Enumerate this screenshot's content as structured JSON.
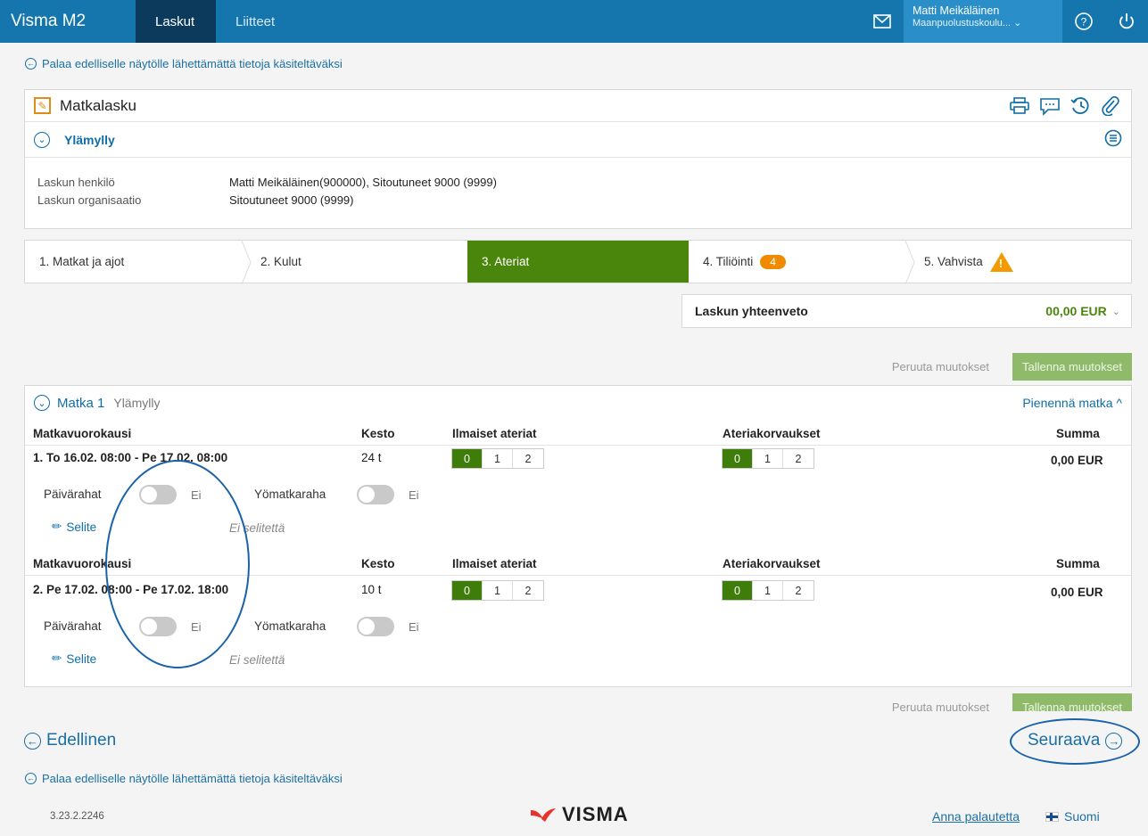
{
  "app": {
    "brand": "Visma M2"
  },
  "nav": {
    "tabs": [
      {
        "label": "Laskut"
      },
      {
        "label": "Liitteet"
      }
    ]
  },
  "user": {
    "name": "Matti Meikäläinen",
    "org": "Maanpuolustuskoulu..."
  },
  "back_link_top": "Palaa edelliselle näytölle lähettämättä tietoja käsiteltäväksi",
  "back_link_bottom": "Palaa edelliselle näytölle lähettämättä tietoja käsiteltäväksi",
  "invoice": {
    "title": "Matkalasku",
    "trip_name": "Ylämylly",
    "person_label": "Laskun henkilö",
    "person_value": "Matti Meikäläinen(900000), Sitoutuneet 9000 (9999)",
    "org_label": "Laskun organisaatio",
    "org_value": "Sitoutuneet 9000 (9999)"
  },
  "steps": [
    {
      "label": "1. Matkat ja ajot"
    },
    {
      "label": "2. Kulut"
    },
    {
      "label": "3. Ateriat"
    },
    {
      "label": "4. Tiliöinti",
      "badge": "4"
    },
    {
      "label": "5. Vahvista"
    }
  ],
  "summary": {
    "label": "Laskun yhteenveto",
    "amount": "00,00 EUR"
  },
  "actions": {
    "cancel": "Peruuta muutokset",
    "save": "Tallenna muutokset"
  },
  "trip": {
    "label": "Matka 1",
    "name": "Ylämylly",
    "collapse": "Pienennä matka",
    "columns": {
      "period": "Matkavuorokausi",
      "duration": "Kesto",
      "free_meals": "Ilmaiset ateriat",
      "meal_comp": "Ateriakorvaukset",
      "sum": "Summa"
    },
    "days": [
      {
        "period": "1. To 16.02. 08:00 - Pe 17.02. 08:00",
        "duration": "24 t",
        "free_meals": [
          "0",
          "1",
          "2"
        ],
        "meal_comp": [
          "0",
          "1",
          "2"
        ],
        "sum": "0,00 EUR",
        "allowance_label": "Päivärahat",
        "allowance_value": "Ei",
        "night_label": "Yömatkaraha",
        "night_value": "Ei",
        "note_label": "Selite",
        "note_value": "Ei selitettä"
      },
      {
        "period": "2. Pe 17.02. 08:00 - Pe 17.02. 18:00",
        "duration": "10 t",
        "free_meals": [
          "0",
          "1",
          "2"
        ],
        "meal_comp": [
          "0",
          "1",
          "2"
        ],
        "sum": "0,00 EUR",
        "allowance_label": "Päivärahat",
        "allowance_value": "Ei",
        "night_label": "Yömatkaraha",
        "night_value": "Ei",
        "note_label": "Selite",
        "note_value": "Ei selitettä"
      }
    ]
  },
  "footer_nav": {
    "previous": "Edellinen",
    "next": "Seuraava"
  },
  "footer": {
    "version": "3.23.2.2246",
    "logo": "VISMA",
    "feedback": "Anna palautetta",
    "language": "Suomi"
  },
  "colors": {
    "primary": "#1576ad",
    "accent_green": "#4a860c",
    "badge_orange": "#f08a00"
  }
}
